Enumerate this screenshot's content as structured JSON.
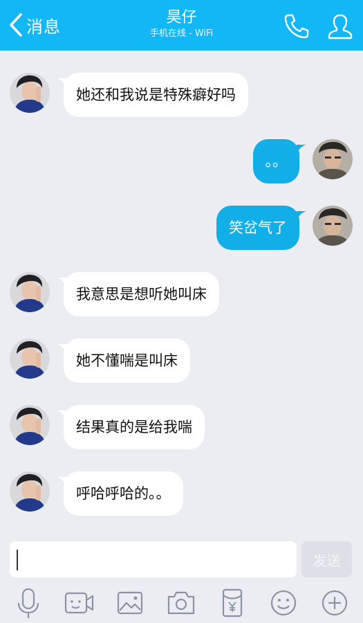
{
  "header": {
    "back_label": "消息",
    "title": "昊仔",
    "subtitle": "手机在线 - WiFi"
  },
  "messages": [
    {
      "side": "left",
      "text": "她还和我说是特殊癖好吗"
    },
    {
      "side": "right",
      "text": "。。"
    },
    {
      "side": "right",
      "text": "笑岔气了"
    },
    {
      "side": "left",
      "text": "我意思是想听她叫床"
    },
    {
      "side": "left",
      "text": "她不懂喘是叫床"
    },
    {
      "side": "left",
      "text": "结果真的是给我喘"
    },
    {
      "side": "left",
      "text": "呼哈呼哈的。。"
    }
  ],
  "composer": {
    "value": "",
    "send_label": "发送"
  },
  "toolbar_icons": [
    "microphone-icon",
    "video-icon",
    "image-icon",
    "camera-icon",
    "red-packet-icon",
    "emoji-icon",
    "plus-icon"
  ],
  "colors": {
    "accent": "#12b7f5",
    "background": "#ebedf3",
    "sent_bubble": "#12aee8",
    "received_bubble": "#ffffff"
  }
}
